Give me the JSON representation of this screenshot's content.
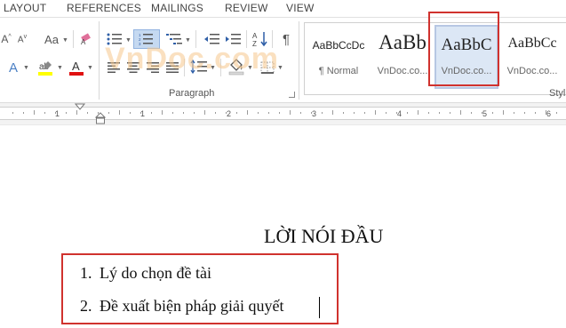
{
  "ribbon_tabs": [
    "LAYOUT",
    "REFERENCES",
    "MAILINGS",
    "REVIEW",
    "VIEW"
  ],
  "ribbon": {
    "paragraph_group_label": "Paragraph",
    "styles_group_label": "Styl",
    "watermark": "VnDoc.com",
    "styles": [
      {
        "sample": "AaBbCcDc",
        "caption": "¶ Normal"
      },
      {
        "sample": "AaBb",
        "caption": "VnDoc.co..."
      },
      {
        "sample": "AaBbC",
        "caption": "VnDoc.co...",
        "selected": true
      },
      {
        "sample": "AaBbCc",
        "caption": "VnDoc.co..."
      }
    ],
    "font_case_label": "Aa",
    "font_size_label": "A",
    "accent_colors": {
      "highlight": "#ffff00",
      "font_color": "#e01010",
      "annotation": "#d0322e"
    }
  },
  "ruler": {
    "numbers": [
      "1",
      "1",
      "2",
      "3",
      "4",
      "5",
      "6"
    ]
  },
  "document": {
    "title": "LỜI NÓI ĐẦU",
    "list": [
      {
        "num": "1.",
        "text": "Lý do chọn đề tài"
      },
      {
        "num": "2.",
        "text": "Đề xuất biện pháp giải quyết"
      }
    ]
  }
}
